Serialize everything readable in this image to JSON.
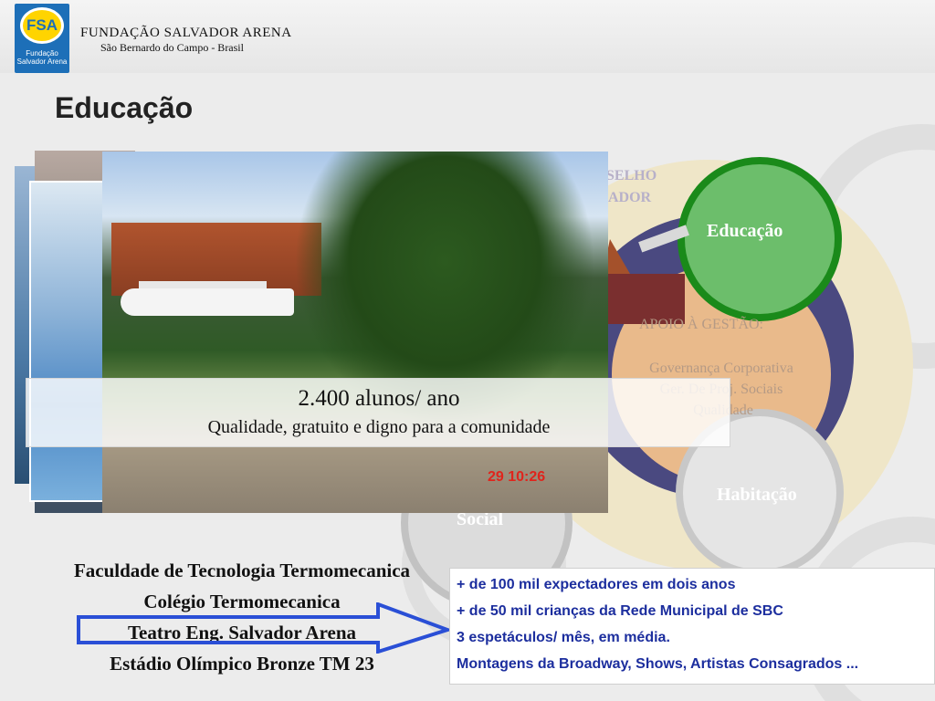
{
  "header": {
    "logo_badge": "FSA",
    "logo_text": "Fundação Salvador Arena",
    "org_name": "FUNDAÇÃO SALVADOR ARENA",
    "org_sub": "São Bernardo do Campo - Brasil"
  },
  "page_title": "Educação",
  "diagram": {
    "education_label": "Educação",
    "housing_label": "Habitação",
    "social_label": "Social",
    "council_label_1": "SELHO",
    "council_label_2": "ADOR",
    "support_label": "APOIO À GESTÃO:",
    "support_items": [
      "Governança Corporativa",
      "Ger. De Proj. Sociais",
      "Qualidade"
    ]
  },
  "photo": {
    "timestamp": "29  10:26"
  },
  "caption": {
    "title": "2.400 alunos/ ano",
    "subtitle": "Qualidade, gratuito e digno para a comunidade"
  },
  "institutions": [
    "Faculdade de Tecnologia Termomecanica",
    "Colégio Termomecanica",
    "Teatro Eng. Salvador Arena",
    "Estádio Olímpico Bronze TM 23"
  ],
  "theater_info": [
    "+ de 100 mil expectadores em dois anos",
    "+ de 50 mil crianças da Rede Municipal de SBC",
    "3 espetáculos/ mês, em média.",
    "Montagens da Broadway, Shows, Artistas Consagrados ..."
  ],
  "colors": {
    "education_circle": "#1a8a1a",
    "info_text": "#1c2e9e",
    "arrow": "#2a4fd6"
  }
}
